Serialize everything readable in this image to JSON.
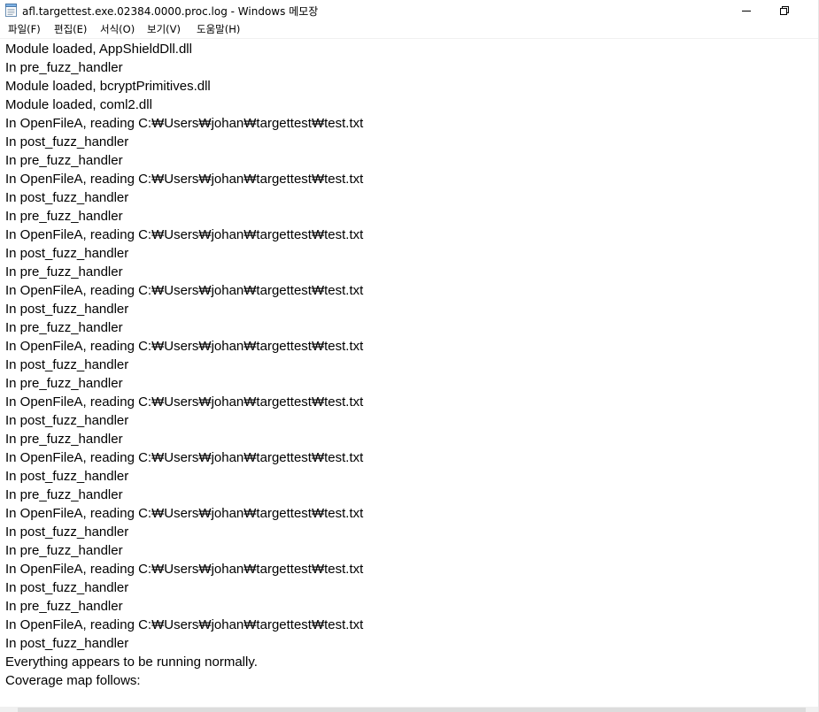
{
  "window": {
    "title": "afl.targettest.exe.02384.0000.proc.log - Windows 메모장"
  },
  "icons": {
    "app": "notepad-icon",
    "minimize": "minimize-icon",
    "restore": "restore-icon"
  },
  "menu": {
    "items": [
      {
        "label": "파일(F)"
      },
      {
        "label": "편집(E)"
      },
      {
        "label": "서식(O)"
      },
      {
        "label": "보기(V)"
      },
      {
        "label": "도움말(H)"
      }
    ]
  },
  "editor": {
    "lines": [
      "Module loaded, AppShieldDll.dll",
      "In pre_fuzz_handler",
      "Module loaded, bcryptPrimitives.dll",
      "Module loaded, coml2.dll",
      "In OpenFileA, reading C:₩Users₩johan₩targettest₩test.txt",
      "In post_fuzz_handler",
      "In pre_fuzz_handler",
      "In OpenFileA, reading C:₩Users₩johan₩targettest₩test.txt",
      "In post_fuzz_handler",
      "In pre_fuzz_handler",
      "In OpenFileA, reading C:₩Users₩johan₩targettest₩test.txt",
      "In post_fuzz_handler",
      "In pre_fuzz_handler",
      "In OpenFileA, reading C:₩Users₩johan₩targettest₩test.txt",
      "In post_fuzz_handler",
      "In pre_fuzz_handler",
      "In OpenFileA, reading C:₩Users₩johan₩targettest₩test.txt",
      "In post_fuzz_handler",
      "In pre_fuzz_handler",
      "In OpenFileA, reading C:₩Users₩johan₩targettest₩test.txt",
      "In post_fuzz_handler",
      "In pre_fuzz_handler",
      "In OpenFileA, reading C:₩Users₩johan₩targettest₩test.txt",
      "In post_fuzz_handler",
      "In pre_fuzz_handler",
      "In OpenFileA, reading C:₩Users₩johan₩targettest₩test.txt",
      "In post_fuzz_handler",
      "In pre_fuzz_handler",
      "In OpenFileA, reading C:₩Users₩johan₩targettest₩test.txt",
      "In post_fuzz_handler",
      "In pre_fuzz_handler",
      "In OpenFileA, reading C:₩Users₩johan₩targettest₩test.txt",
      "In post_fuzz_handler",
      "Everything appears to be running normally.",
      "Coverage map follows:"
    ]
  }
}
